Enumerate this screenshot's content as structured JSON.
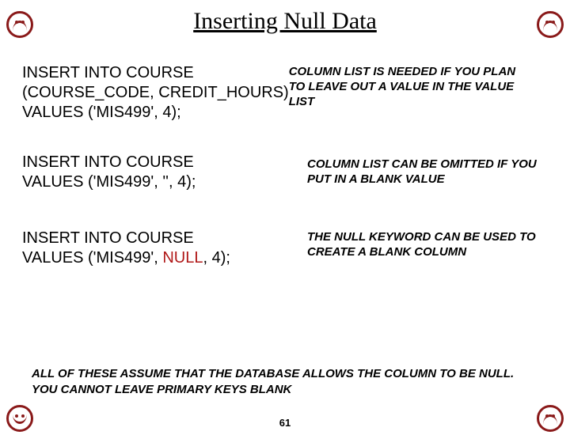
{
  "title": "Inserting Null Data",
  "examples": [
    {
      "sql_lines": [
        "INSERT INTO COURSE",
        "(COURSE_CODE, CREDIT_HOURS)",
        "VALUES ('MIS499', 4);"
      ],
      "note": "COLUMN LIST IS NEEDED IF YOU PLAN TO LEAVE OUT A VALUE IN THE VALUE LIST"
    },
    {
      "sql_lines": [
        "INSERT INTO COURSE",
        "VALUES ('MIS499', '', 4);"
      ],
      "note": "COLUMN LIST CAN BE OMITTED IF YOU PUT IN A BLANK VALUE"
    },
    {
      "sql_lines": [
        "INSERT INTO COURSE",
        "VALUES ('MIS499', "
      ],
      "null_kw": "NULL",
      "sql_tail": ", 4);",
      "note": "THE NULL KEYWORD CAN BE USED TO CREATE A BLANK COLUMN"
    }
  ],
  "footer": "ALL OF THESE ASSUME THAT THE DATABASE ALLOWS THE COLUMN TO BE NULL.  YOU CANNOT LEAVE PRIMARY KEYS BLANK",
  "page": "61"
}
